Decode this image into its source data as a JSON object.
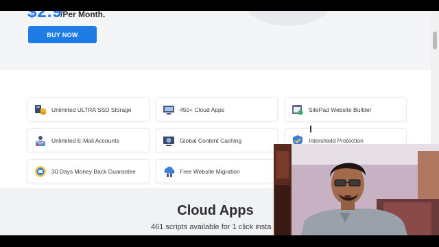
{
  "pricing": {
    "price_fragment": "$2.9",
    "per_month": "/Per Month.",
    "buy_label": "BUY NOW"
  },
  "features": [
    {
      "label": "Unlimited ULTRA SSD Storage",
      "icon": "ssd-storage-icon"
    },
    {
      "label": "450+ Cloud Apps",
      "icon": "cloud-apps-icon"
    },
    {
      "label": "SitePad Website Builder",
      "icon": "website-builder-icon"
    },
    {
      "label": "Unlimited E-Mail Accounts",
      "icon": "email-accounts-icon"
    },
    {
      "label": "Global Content Caching",
      "icon": "content-caching-icon"
    },
    {
      "label": "Intershield Protection",
      "icon": "shield-icon"
    },
    {
      "label": "30 Days Money Back Guarantee",
      "icon": "money-back-icon"
    },
    {
      "label": "Free Website Migration",
      "icon": "migration-icon"
    }
  ],
  "cloud_section": {
    "title": "Cloud Apps",
    "subtitle": "461 scripts available for 1 click insta"
  },
  "colors": {
    "accent": "#1f7be6",
    "section_bg": "#f4f5f7"
  }
}
